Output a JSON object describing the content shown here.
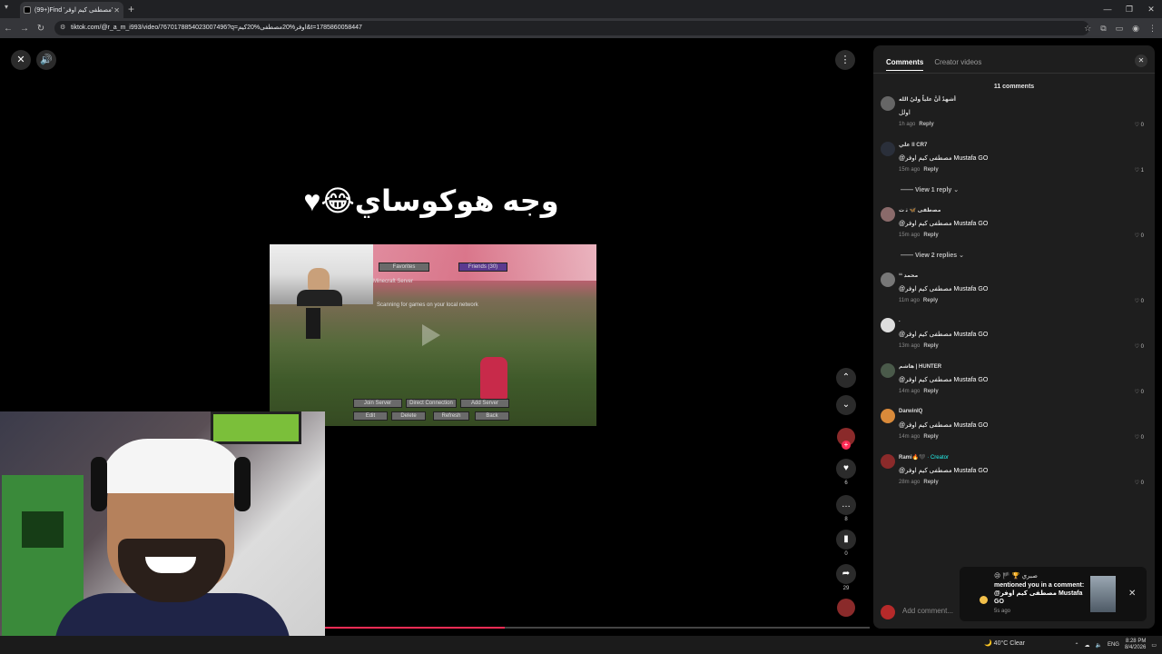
{
  "browser": {
    "tab_title": "(99+)Find 'مصطفى كيم اوفر'",
    "new_tab_icon": "+",
    "url": "tiktok.com/@r_a_m_i993/video/7670178854023007496?q=اوفر%20مصطفى%20كيم&t=1785860058447"
  },
  "player": {
    "caption": "وجه هوكوساي😂♥",
    "progress": 0.33,
    "actions": {
      "likes": "6",
      "comments": "8",
      "saves": "0",
      "shares": "29"
    }
  },
  "minecraft": {
    "favorites": "Favorites",
    "friends": "Friends (30)",
    "server": "Minecraft Server",
    "scanning": "Scanning for games on your local network",
    "join": "Join Server",
    "direct": "Direct Connection",
    "add": "Add Server",
    "edit": "Edit",
    "delete": "Delete",
    "refresh": "Refresh",
    "back": "Back"
  },
  "panel": {
    "tab_comments": "Comments",
    "tab_creator": "Creator videos",
    "count": "11 comments",
    "comments": [
      {
        "user": "أشهدُ أنَّ علياً وليُ الله",
        "text": "اولل",
        "time": "1h ago",
        "reply": "Reply",
        "likes": "0"
      },
      {
        "user": "علي ll CR7",
        "text": "@مصطفى كيم اوفر Mustafa GO",
        "time": "15m ago",
        "reply": "Reply",
        "likes": "1"
      },
      {
        "user": "ﻣﺼﻃﻔﻰ 🦋 ﭠ ﺕ",
        "text": "@مصطفى كيم اوفر Mustafa GO",
        "time": "15m ago",
        "reply": "Reply",
        "likes": "0"
      },
      {
        "user": "محمد ¹¹",
        "text": "@مصطفى كيم اوفر Mustafa GO",
        "time": "11m ago",
        "reply": "Reply",
        "likes": "0"
      },
      {
        "user": ".",
        "text": "@مصطفى كيم اوفر Mustafa GO",
        "time": "13m ago",
        "reply": "Reply",
        "likes": "0"
      },
      {
        "user": "هاشم | HUNTER",
        "text": "@مصطفى كيم اوفر Mustafa GO",
        "time": "14m ago",
        "reply": "Reply",
        "likes": "0"
      },
      {
        "user": "DarwinIQ",
        "text": "@مصطفى كيم اوفر Mustafa GO",
        "time": "14m ago",
        "reply": "Reply",
        "likes": "0"
      },
      {
        "user": "Rami🔥🖤",
        "creator": "· Creator",
        "text": "@مصطفى كيم اوفر Mustafa GO",
        "time": "28m ago",
        "reply": "Reply",
        "likes": "0"
      }
    ],
    "view_reply_1": "View 1 reply",
    "view_reply_2": "View 2 replies",
    "add_comment": "Add comment..."
  },
  "notification": {
    "line1": "😢 🏴 🏆 صبري",
    "line2": "mentioned you in a comment: @مصطفى كيم اوفر Mustafa GO",
    "time": "5s ago"
  },
  "taskbar": {
    "weather": "40°C  Clear",
    "lang": "ENG",
    "time": "8:28 PM",
    "date": "8/4/2026"
  },
  "colors": {
    "accent": "#fe2c55",
    "creator": "#25f4ee",
    "panel_bg": "#1e1e1e"
  }
}
